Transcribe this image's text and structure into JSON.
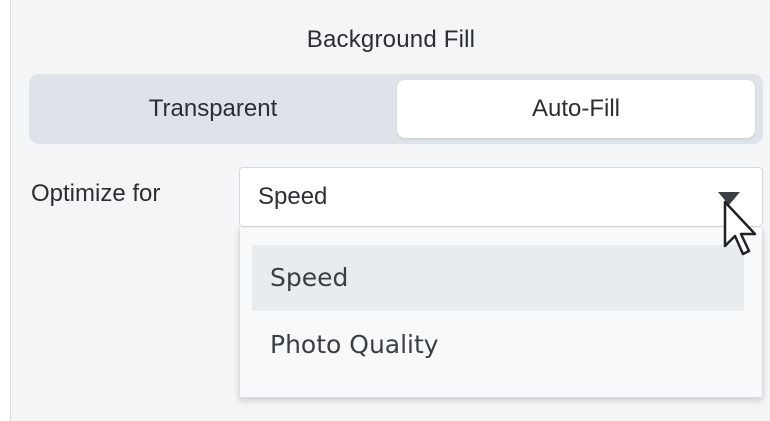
{
  "background_fill": {
    "title": "Background Fill",
    "options": [
      "Transparent",
      "Auto-Fill"
    ],
    "selected": "Auto-Fill"
  },
  "optimize": {
    "label": "Optimize for",
    "value": "Speed",
    "options": [
      "Speed",
      "Photo Quality"
    ],
    "highlighted": "Speed"
  },
  "icons": {
    "dropdown_caret": "chevron-down-icon",
    "cursor": "mouse-pointer-icon"
  },
  "colors": {
    "panel_bg": "#f3f5f7",
    "segmented_bg": "#dde3e8",
    "selected_segment": "#ffffff",
    "text": "#2b2f33"
  }
}
